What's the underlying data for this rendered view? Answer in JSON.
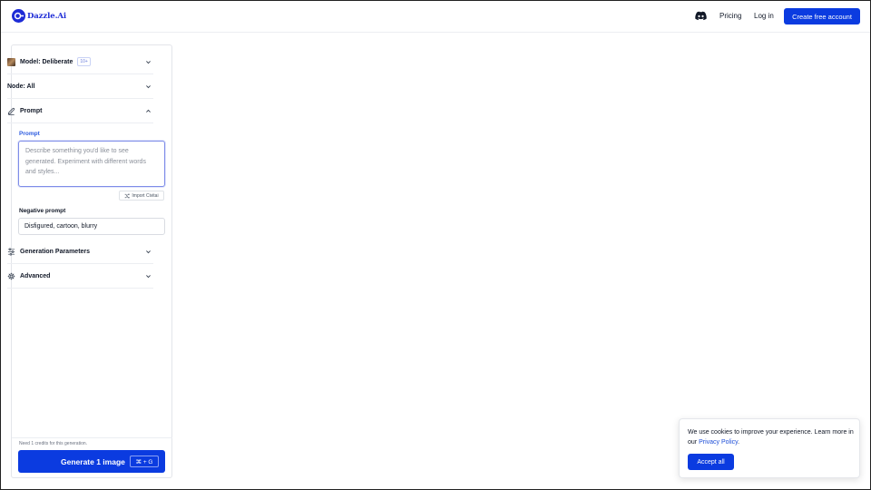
{
  "brand": {
    "name": "Dazzle.Ai",
    "color": "#1d2bd6"
  },
  "nav": {
    "pricing": "Pricing",
    "login": "Log in",
    "cta": "Create free account"
  },
  "panel": {
    "model": {
      "label": "Model: Deliberate",
      "badge": "10+"
    },
    "node": {
      "label": "Node: All"
    },
    "prompt_section": {
      "label": "Prompt"
    },
    "prompt": {
      "label": "Prompt",
      "placeholder": "Describe something you'd like to see generated. Experiment with different words and styles...",
      "import_label": "Import Civitai"
    },
    "negative": {
      "label": "Negative prompt",
      "value": "Disfigured, cartoon, blurry"
    },
    "generation": {
      "label": "Generation Parameters"
    },
    "advanced": {
      "label": "Advanced"
    },
    "credits": "Need 1 credits for this generation.",
    "generate": {
      "label": "Generate 1 image",
      "shortcut": "⌘ + G"
    }
  },
  "cookie": {
    "text": "We use cookies to improve your experience. Learn more in our ",
    "link": "Privacy Policy",
    "suffix": ".",
    "accept": "Accept all"
  },
  "colors": {
    "accent": "#0b3be0",
    "focus": "#7f8de8"
  }
}
